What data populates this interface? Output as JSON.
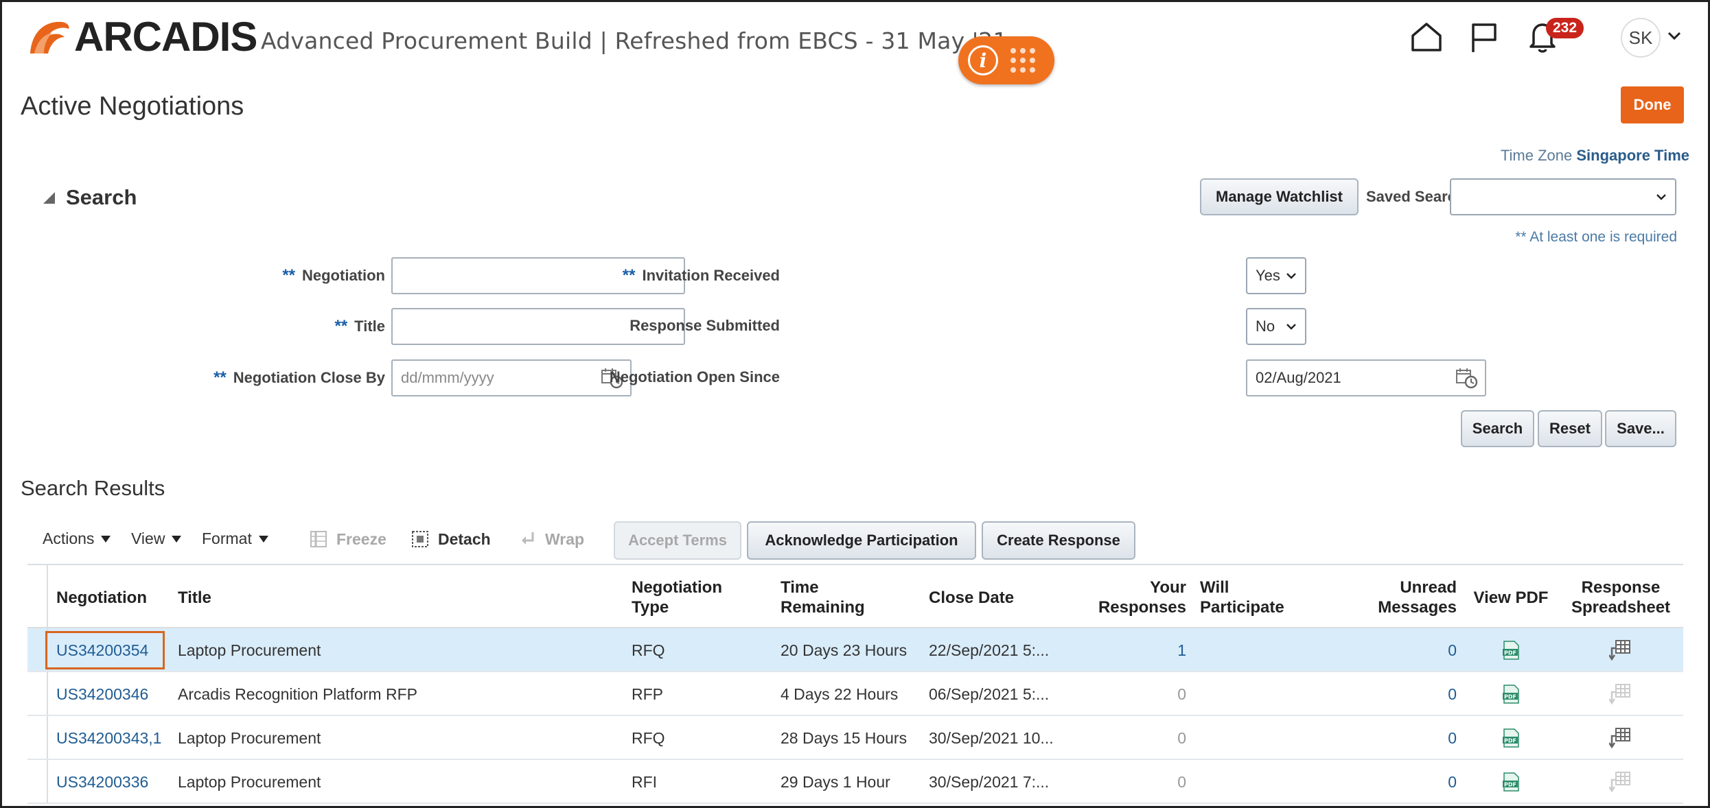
{
  "header": {
    "logo_text": "ARCADIS",
    "app_title": "Advanced Procurement Build | Refreshed from EBCS - 31 May '21",
    "info_icon_glyph": "i",
    "notification_count": "232",
    "user_initials": "SK",
    "brand_color": "#e8641a"
  },
  "page": {
    "title": "Active Negotiations",
    "done_label": "Done",
    "timezone_label": "Time Zone",
    "timezone_value": "Singapore Time"
  },
  "search": {
    "section_title": "Search",
    "manage_watchlist_label": "Manage Watchlist",
    "saved_search_label": "Saved Search",
    "saved_search_value": "",
    "required_note": "** At least one is required",
    "required_marker": "**",
    "negotiation_label": "Negotiation",
    "negotiation_value": "",
    "title_label": "Title",
    "title_value": "",
    "close_by_label": "Negotiation Close By",
    "close_by_placeholder": "dd/mmm/yyyy",
    "invitation_label": "Invitation Received",
    "invitation_value": "Yes",
    "response_submitted_label": "Response Submitted",
    "response_submitted_value": "No",
    "open_since_label": "Negotiation Open Since",
    "open_since_value": "02/Aug/2021",
    "search_button": "Search",
    "reset_button": "Reset",
    "save_button": "Save..."
  },
  "results": {
    "title": "Search Results",
    "toolbar": {
      "actions": "Actions",
      "view": "View",
      "format": "Format",
      "freeze": "Freeze",
      "detach": "Detach",
      "wrap": "Wrap",
      "accept_terms": "Accept Terms",
      "acknowledge": "Acknowledge Participation",
      "create_response": "Create Response"
    },
    "columns": {
      "negotiation": "Negotiation",
      "title": "Title",
      "type": "Negotiation Type",
      "time_remaining": "Time Remaining",
      "close_date": "Close Date",
      "your_responses": "Your Responses",
      "will_participate": "Will Participate",
      "unread_messages": "Unread Messages",
      "view_pdf": "View PDF",
      "response_spreadsheet": "Response Spreadsheet"
    },
    "rows": [
      {
        "negotiation": "US34200354",
        "title": "Laptop Procurement",
        "type": "RFQ",
        "time_remaining": "20 Days 23 Hours",
        "close_date": "22/Sep/2021 5:...",
        "your_responses": "1",
        "will_participate": "",
        "unread": "0",
        "pdf_icon": "pdf-icon",
        "spreadsheet_icon": "spreadsheet-icon",
        "spreadsheet_enabled": true
      },
      {
        "negotiation": "US34200346",
        "title": "Arcadis Recognition Platform RFP",
        "type": "RFP",
        "time_remaining": "4 Days 22 Hours",
        "close_date": "06/Sep/2021 5:...",
        "your_responses": "0",
        "will_participate": "",
        "unread": "0",
        "pdf_icon": "pdf-icon",
        "spreadsheet_icon": "spreadsheet-icon",
        "spreadsheet_enabled": false
      },
      {
        "negotiation": "US34200343,1",
        "title": "Laptop Procurement",
        "type": "RFQ",
        "time_remaining": "28 Days 15 Hours",
        "close_date": "30/Sep/2021 10...",
        "your_responses": "0",
        "will_participate": "",
        "unread": "0",
        "pdf_icon": "pdf-icon",
        "spreadsheet_icon": "spreadsheet-icon",
        "spreadsheet_enabled": true
      },
      {
        "negotiation": "US34200336",
        "title": "Laptop Procurement",
        "type": "RFI",
        "time_remaining": "29 Days 1 Hour",
        "close_date": "30/Sep/2021 7:...",
        "your_responses": "0",
        "will_participate": "",
        "unread": "0",
        "pdf_icon": "pdf-icon",
        "spreadsheet_icon": "spreadsheet-icon",
        "spreadsheet_enabled": false
      }
    ]
  }
}
